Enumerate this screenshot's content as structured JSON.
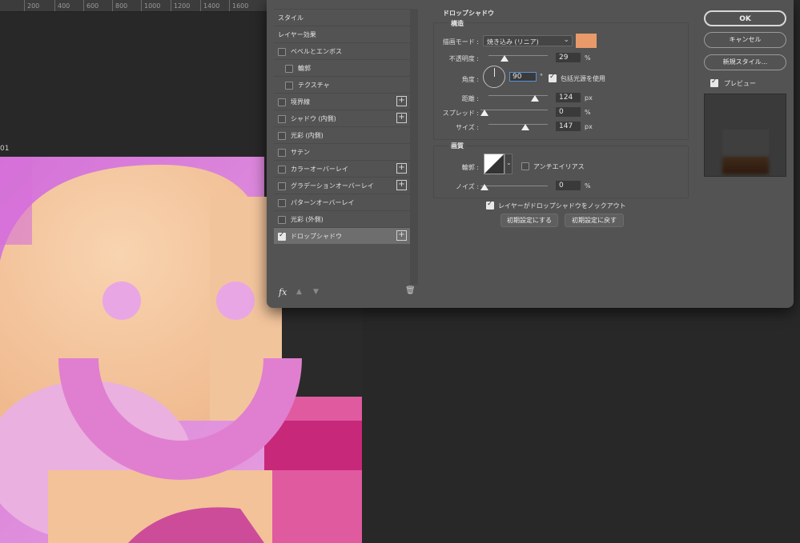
{
  "ruler": {
    "ticks": [
      "200",
      "400",
      "600",
      "800",
      "1000",
      "1200",
      "1400",
      "1600"
    ]
  },
  "workspace": {
    "doc_label": "01"
  },
  "dialog": {
    "styles_list": [
      {
        "label": "スタイル",
        "checkbox": false,
        "checked": false,
        "plus": false,
        "indent": 0,
        "selected": false
      },
      {
        "label": "レイヤー効果",
        "checkbox": false,
        "checked": false,
        "plus": false,
        "indent": 0,
        "selected": false
      },
      {
        "label": "ベベルとエンボス",
        "checkbox": true,
        "checked": false,
        "plus": false,
        "indent": 0,
        "selected": false
      },
      {
        "label": "輪郭",
        "checkbox": true,
        "checked": false,
        "plus": false,
        "indent": 1,
        "selected": false
      },
      {
        "label": "テクスチャ",
        "checkbox": true,
        "checked": false,
        "plus": false,
        "indent": 1,
        "selected": false
      },
      {
        "label": "境界線",
        "checkbox": true,
        "checked": false,
        "plus": true,
        "indent": 0,
        "selected": false
      },
      {
        "label": "シャドウ (内側)",
        "checkbox": true,
        "checked": false,
        "plus": true,
        "indent": 0,
        "selected": false
      },
      {
        "label": "光彩 (内側)",
        "checkbox": true,
        "checked": false,
        "plus": false,
        "indent": 0,
        "selected": false
      },
      {
        "label": "サテン",
        "checkbox": true,
        "checked": false,
        "plus": false,
        "indent": 0,
        "selected": false
      },
      {
        "label": "カラーオーバーレイ",
        "checkbox": true,
        "checked": false,
        "plus": true,
        "indent": 0,
        "selected": false
      },
      {
        "label": "グラデーションオーバーレイ",
        "checkbox": true,
        "checked": false,
        "plus": true,
        "indent": 0,
        "selected": false
      },
      {
        "label": "パターンオーバーレイ",
        "checkbox": true,
        "checked": false,
        "plus": false,
        "indent": 0,
        "selected": false
      },
      {
        "label": "光彩 (外側)",
        "checkbox": true,
        "checked": false,
        "plus": false,
        "indent": 0,
        "selected": false
      },
      {
        "label": "ドロップシャドウ",
        "checkbox": true,
        "checked": true,
        "plus": true,
        "indent": 0,
        "selected": true
      }
    ],
    "footer_icons": {
      "fx": "fx",
      "up": "▲",
      "down": "▼",
      "trash": "🗑"
    },
    "drop_shadow": {
      "title": "ドロップシャドウ",
      "structure_title": "構造",
      "blend_mode_label": "描画モード :",
      "blend_mode_value": "焼き込み (リニア)",
      "shadow_color": "#e89a6a",
      "opacity_label": "不透明度 :",
      "opacity_value": "29",
      "opacity_unit": "%",
      "angle_label": "角度 :",
      "angle_value": "90",
      "angle_unit": "°",
      "global_light_label": "包括光源を使用",
      "global_light_checked": true,
      "distance_label": "距離 :",
      "distance_value": "124",
      "distance_unit": "px",
      "spread_label": "スプレッド :",
      "spread_value": "0",
      "spread_unit": "%",
      "size_label": "サイズ :",
      "size_value": "147",
      "size_unit": "px",
      "quality_title": "画質",
      "contour_label": "輪郭 :",
      "antialias_label": "アンチエイリアス",
      "antialias_checked": false,
      "noise_label": "ノイズ :",
      "noise_value": "0",
      "noise_unit": "%",
      "knockout_label": "レイヤーがドロップシャドウをノックアウト",
      "knockout_checked": true,
      "make_default_label": "初期設定にする",
      "reset_default_label": "初期設定に戻す"
    },
    "buttons": {
      "ok": "OK",
      "cancel": "キャンセル",
      "new_style": "新規スタイル...",
      "preview_label": "プレビュー",
      "preview_checked": true
    }
  }
}
